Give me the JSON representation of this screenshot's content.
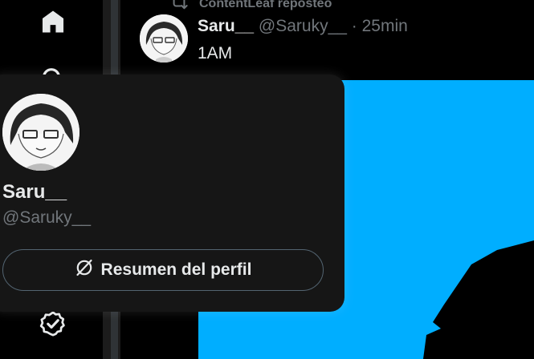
{
  "repost": {
    "text": "ContentLeaf reposteó"
  },
  "tweet": {
    "name": "Saru__",
    "handle": "@Saruky__",
    "separator": "·",
    "time": "25min",
    "text": "1AM"
  },
  "hover_card": {
    "name": "Saru__",
    "handle": "@Saruky__",
    "button_label": "Resumen del perfil",
    "button_icon": "grok-icon"
  },
  "nav": {
    "icons": [
      "home-icon",
      "search-icon",
      "verified-icon"
    ]
  },
  "colors": {
    "media_background": "#00aeff",
    "card_background": "#161616",
    "muted_text": "#71767b"
  }
}
